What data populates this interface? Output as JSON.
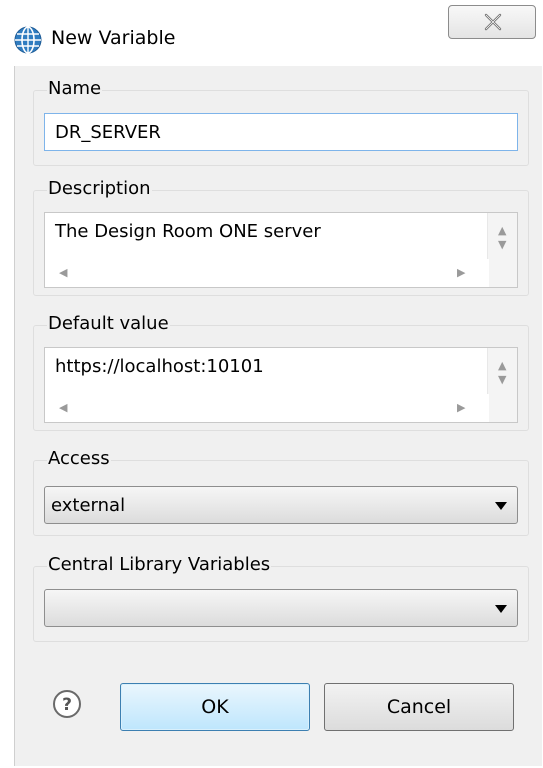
{
  "window": {
    "title": "New Variable",
    "icon": "globe-icon",
    "close_icon": "close-icon"
  },
  "name_group": {
    "label": "Name",
    "value": "DR_SERVER"
  },
  "description_group": {
    "label": "Description",
    "value": "The Design Room ONE server"
  },
  "default_value_group": {
    "label": "Default value",
    "value": "https://localhost:10101"
  },
  "access_group": {
    "label": "Access",
    "selected": "external"
  },
  "central_library_group": {
    "label": "Central Library Variables",
    "selected": ""
  },
  "buttons": {
    "help_icon": "help-icon",
    "ok_label": "OK",
    "cancel_label": "Cancel"
  },
  "colors": {
    "ok_border": "#3c7fb1",
    "input_focus_border": "#7eb4ea",
    "dialog_background": "#f0f0f0"
  }
}
